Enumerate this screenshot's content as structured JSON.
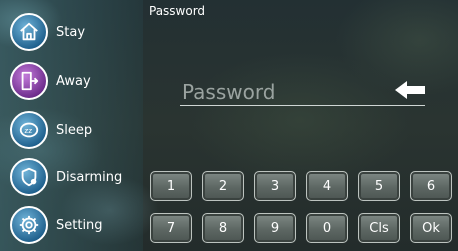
{
  "header": {
    "title": "Password"
  },
  "sidebar": {
    "items": [
      {
        "label": "Stay",
        "icon": "home-icon"
      },
      {
        "label": "Away",
        "icon": "exit-door-icon"
      },
      {
        "label": "Sleep",
        "icon": "sleep-icon"
      },
      {
        "label": "Disarming",
        "icon": "disarm-shield-icon"
      },
      {
        "label": "Setting",
        "icon": "gear-icon"
      }
    ]
  },
  "password": {
    "placeholder": "Password",
    "value": ""
  },
  "keypad": {
    "row1": [
      "1",
      "2",
      "3",
      "4",
      "5",
      "6"
    ],
    "row2": [
      "7",
      "8",
      "9",
      "0",
      "Cls",
      "Ok"
    ]
  },
  "colors": {
    "icon_blue": "#1e5f8c",
    "icon_purple_active": "#6b2a8a",
    "key_fill": "#5d6763",
    "text": "#ffffff"
  }
}
